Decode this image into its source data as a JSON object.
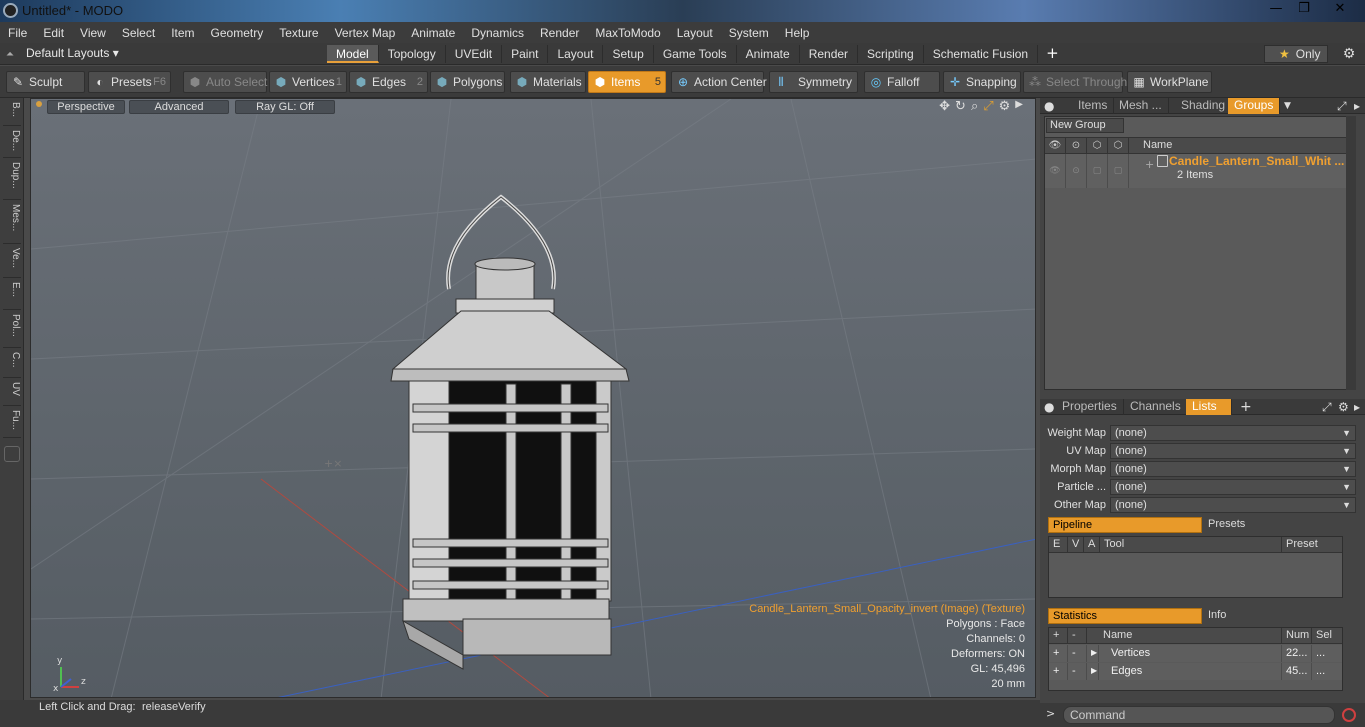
{
  "window": {
    "title": "Untitled* - MODO",
    "minimize": "—",
    "maximize": "❐",
    "close": "✕"
  },
  "menu": [
    "File",
    "Edit",
    "View",
    "Select",
    "Item",
    "Geometry",
    "Texture",
    "Vertex Map",
    "Animate",
    "Dynamics",
    "Render",
    "MaxToModo",
    "Layout",
    "System",
    "Help"
  ],
  "layouts": {
    "label": "Default Layouts ▾",
    "tabs": [
      "Model",
      "Topology",
      "UVEdit",
      "Paint",
      "Layout",
      "Setup",
      "Game Tools",
      "Animate",
      "Render",
      "Scripting",
      "Schematic Fusion"
    ],
    "active_tab": "Model",
    "add": "+",
    "only": "Only"
  },
  "toolbar": {
    "sculpt": "Sculpt",
    "presets": "Presets",
    "presets_key": "F6",
    "auto_select": "Auto Select",
    "vertices": "Vertices",
    "vertices_key": "1",
    "edges": "Edges",
    "edges_key": "2",
    "polygons": "Polygons",
    "materials": "Materials",
    "items": "Items",
    "items_key": "5",
    "action_center": "Action Center",
    "symmetry": "Symmetry",
    "falloff": "Falloff",
    "snapping": "Snapping",
    "select_through": "Select Through",
    "workplane": "WorkPlane"
  },
  "left_strip": [
    "B...",
    "De...",
    "Dup...",
    "Mes...",
    "Ve...",
    "E...",
    "Pol...",
    "C...",
    "UV",
    "Fu..."
  ],
  "viewport": {
    "perspective": "Perspective",
    "advanced": "Advanced",
    "raygl": "Ray GL: Off",
    "stats": {
      "texture": "Candle_Lantern_Small_Opacity_invert (Image) (Texture)",
      "polygons": "Polygons : Face",
      "channels": "Channels: 0",
      "deformers": "Deformers: ON",
      "gl": "GL: 45,496",
      "unit": "20 mm"
    }
  },
  "status": {
    "hint_label": "Left Click and Drag:",
    "hint_value": "releaseVerify"
  },
  "groups_panel": {
    "tabs": [
      "Items",
      "Mesh ...",
      "Shading",
      "Groups"
    ],
    "active_tab": "Groups",
    "new_group": "New Group",
    "name_header": "Name",
    "row": {
      "name": "Candle_Lantern_Small_Whit ...",
      "sub": "2 Items"
    }
  },
  "props_panel": {
    "tabs": [
      "Properties",
      "Channels",
      "Lists"
    ],
    "active_tab": "Lists",
    "add": "+",
    "maps": [
      {
        "label": "Weight Map",
        "value": "(none)"
      },
      {
        "label": "UV Map",
        "value": "(none)"
      },
      {
        "label": "Morph Map",
        "value": "(none)"
      },
      {
        "label": "Particle ...",
        "value": "(none)"
      },
      {
        "label": "Other Map",
        "value": "(none)"
      }
    ],
    "pipeline_tab": "Pipeline",
    "presets_tab": "Presets",
    "pipeline_headers": [
      "E",
      "V",
      "A",
      "Tool",
      "Preset"
    ],
    "statistics_tab": "Statistics",
    "info_tab": "Info",
    "stats_headers": [
      "+",
      "-",
      "Name",
      "Num",
      "Sel"
    ],
    "stats_rows": [
      {
        "plus": "+",
        "minus": "-",
        "name": "Vertices",
        "num": "22...",
        "sel": "..."
      },
      {
        "plus": "+",
        "minus": "-",
        "name": "Edges",
        "num": "45...",
        "sel": "..."
      }
    ]
  },
  "command": {
    "placeholder": "Command",
    "prompt": ">"
  }
}
